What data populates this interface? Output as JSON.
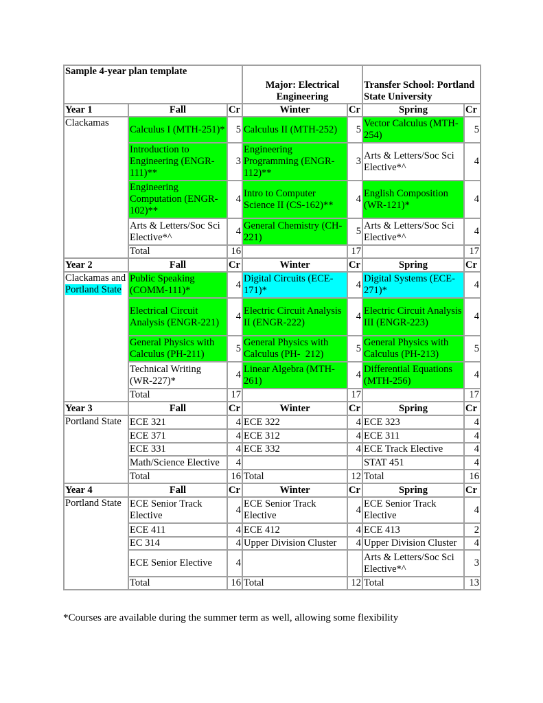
{
  "header": {
    "title": "Sample 4-year plan template",
    "major": "Major: Electrical Engineering",
    "transfer": "Transfer School: Portland State University"
  },
  "colors": {
    "completed_highlight": "#00ff00",
    "transfer_highlight": "#00ffff"
  },
  "col_labels": {
    "fall": "Fall",
    "winter": "Winter",
    "spring": "Spring",
    "cr": "Cr"
  },
  "years": [
    {
      "label": "Year 1",
      "school": "Clackamas",
      "rows": [
        {
          "fall": "Calculus I (MTH-251)*",
          "fall_cr": "5",
          "winter": "Calculus II (MTH-252)",
          "winter_cr": "5",
          "spring": "Vector Calculus (MTH-254)",
          "spring_cr": "5"
        },
        {
          "fall": "Introduction to Engineering (ENGR-111)**",
          "fall_cr": "3",
          "winter": "Engineering Programming (ENGR-112)**",
          "winter_cr": "3",
          "spring": "Arts & Letters/Soc Sci Elective*^",
          "spring_cr": "4"
        },
        {
          "fall": "Engineering Computation (ENGR-102)**",
          "fall_cr": "4",
          "winter": "Intro to Computer Science II (CS-162)**",
          "winter_cr": "4",
          "spring": "English Composition (WR-121)*",
          "spring_cr": "4"
        },
        {
          "fall": "Arts & Letters/Soc Sci Elective*^",
          "fall_cr": "4",
          "winter": "General Chemistry (CH-221)",
          "winter_cr": "5",
          "spring": "Arts & Letters/Soc Sci Elective*^",
          "spring_cr": "4"
        }
      ],
      "total": {
        "fall": "Total",
        "fall_cr": "16",
        "winter": "",
        "winter_cr": "17",
        "spring": "",
        "spring_cr": "17"
      }
    },
    {
      "label": "Year 2",
      "school": "Clackamas and",
      "school_highlight": "Portland State",
      "rows": [
        {
          "fall": "Public Speaking (COMM-111)*",
          "fall_cr": "4",
          "winter": "Digital Circuits (ECE-171)*",
          "winter_cr": "4",
          "spring": "Digital Systems (ECE-271)*",
          "spring_cr": "4"
        },
        {
          "fall": "Electrical Circuit Analysis (ENGR-221)",
          "fall_cr": "4",
          "winter": "Electric Circuit Analysis II (ENGR-222)",
          "winter_cr": "4",
          "spring": "Electric Circuit Analysis III (ENGR-223)",
          "spring_cr": "4"
        },
        {
          "fall": "General Physics with Calculus (PH-211)",
          "fall_cr": "5",
          "winter": "General Physics with Calculus (PH-  212)",
          "winter_cr": "5",
          "spring": "General Physics with Calculus (PH-213)",
          "spring_cr": "5"
        },
        {
          "fall": "Technical Writing (WR-227)*",
          "fall_cr": "4",
          "winter": "Linear Algebra (MTH-261)",
          "winter_cr": "4",
          "spring": "Differential Equations (MTH-256)",
          "spring_cr": "4"
        }
      ],
      "total": {
        "fall": "Total",
        "fall_cr": "17",
        "winter": "",
        "winter_cr": "17",
        "spring": "",
        "spring_cr": "17"
      }
    },
    {
      "label": "Year 3",
      "school": "Portland State",
      "rows": [
        {
          "fall": "ECE 321",
          "fall_cr": "4",
          "winter": "ECE 322",
          "winter_cr": "4",
          "spring": "ECE 323",
          "spring_cr": "4"
        },
        {
          "fall": "ECE 371",
          "fall_cr": "4",
          "winter": "ECE 312",
          "winter_cr": "4",
          "spring": "ECE 311",
          "spring_cr": "4"
        },
        {
          "fall": "ECE 331",
          "fall_cr": "4",
          "winter": "ECE 332",
          "winter_cr": "4",
          "spring": "ECE Track Elective",
          "spring_cr": "4"
        },
        {
          "fall": "Math/Science Elective",
          "fall_cr": "4",
          "winter": "",
          "winter_cr": "",
          "spring": "STAT 451",
          "spring_cr": "4"
        }
      ],
      "total": {
        "fall": "Total",
        "fall_cr": "16",
        "winter": "Total",
        "winter_cr": "12",
        "spring": "Total",
        "spring_cr": "16"
      }
    },
    {
      "label": "Year 4",
      "school": "Portland State",
      "rows": [
        {
          "fall": "ECE Senior Track Elective",
          "fall_cr": "4",
          "winter": "ECE Senior Track Elective",
          "winter_cr": "4",
          "spring": "ECE Senior Track Elective",
          "spring_cr": "4"
        },
        {
          "fall": "ECE 411",
          "fall_cr": "4",
          "winter": "ECE 412",
          "winter_cr": "4",
          "spring": "ECE 413",
          "spring_cr": "2"
        },
        {
          "fall": "EC 314",
          "fall_cr": "4",
          "winter": "Upper Division Cluster",
          "winter_cr": "4",
          "spring": "Upper Division Cluster",
          "spring_cr": "4"
        },
        {
          "fall": "ECE Senior Elective",
          "fall_cr": "4",
          "winter": "",
          "winter_cr": "",
          "spring": "Arts & Letters/Soc Sci Elective*^",
          "spring_cr": "3"
        }
      ],
      "total": {
        "fall": "Total",
        "fall_cr": "16",
        "winter": "Total",
        "winter_cr": "12",
        "spring": "Total",
        "spring_cr": "13"
      }
    }
  ],
  "footnote": "*Courses are available during the summer term as well, allowing some flexibility"
}
